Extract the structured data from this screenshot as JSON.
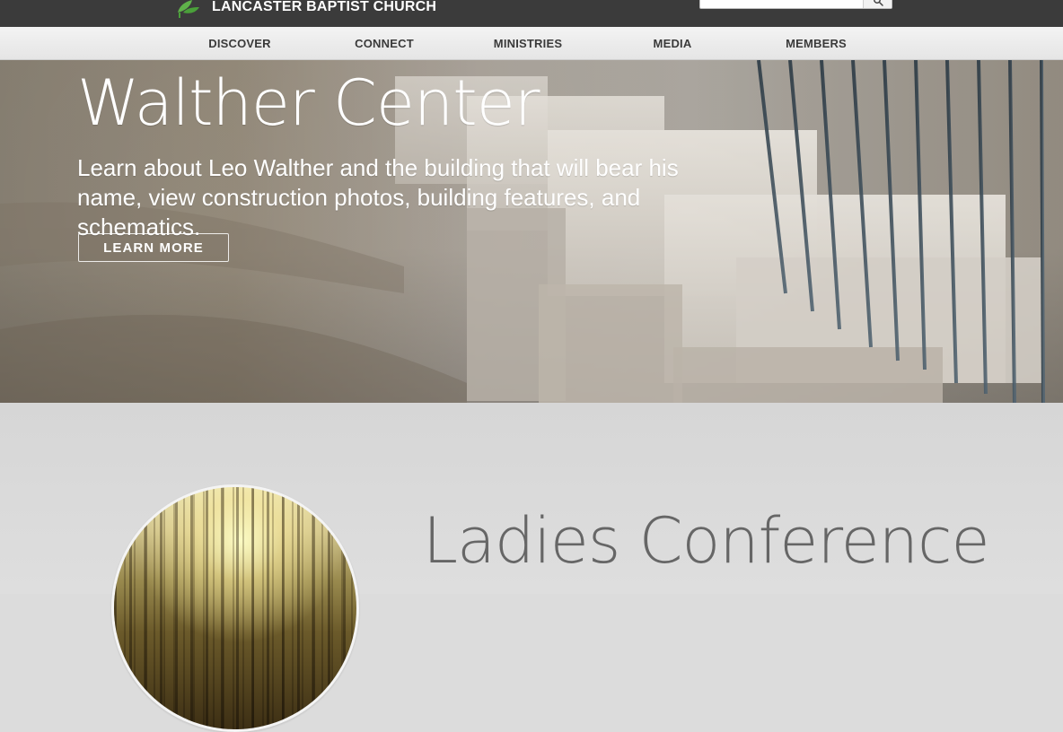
{
  "header": {
    "church_name": "LANCASTER BAPTIST CHURCH",
    "search": {
      "value": "",
      "placeholder": "",
      "icon": "search-icon"
    }
  },
  "nav": {
    "items": [
      {
        "label": "DISCOVER"
      },
      {
        "label": "CONNECT"
      },
      {
        "label": "MINISTRIES"
      },
      {
        "label": "MEDIA"
      },
      {
        "label": "MEMBERS"
      }
    ]
  },
  "hero": {
    "title": "Walther Center",
    "subtitle": "Learn about Leo Walther and the building that will bear his name, view construction photos, building features, and schematics.",
    "cta_label": "LEARN MORE"
  },
  "featured": {
    "title": "Ladies Conference"
  },
  "colors": {
    "topbar": "#3b3b3b",
    "nav_bg": "#eeeeee",
    "text_dark": "#3a3a3a",
    "logo_green": "#5fb24a"
  }
}
